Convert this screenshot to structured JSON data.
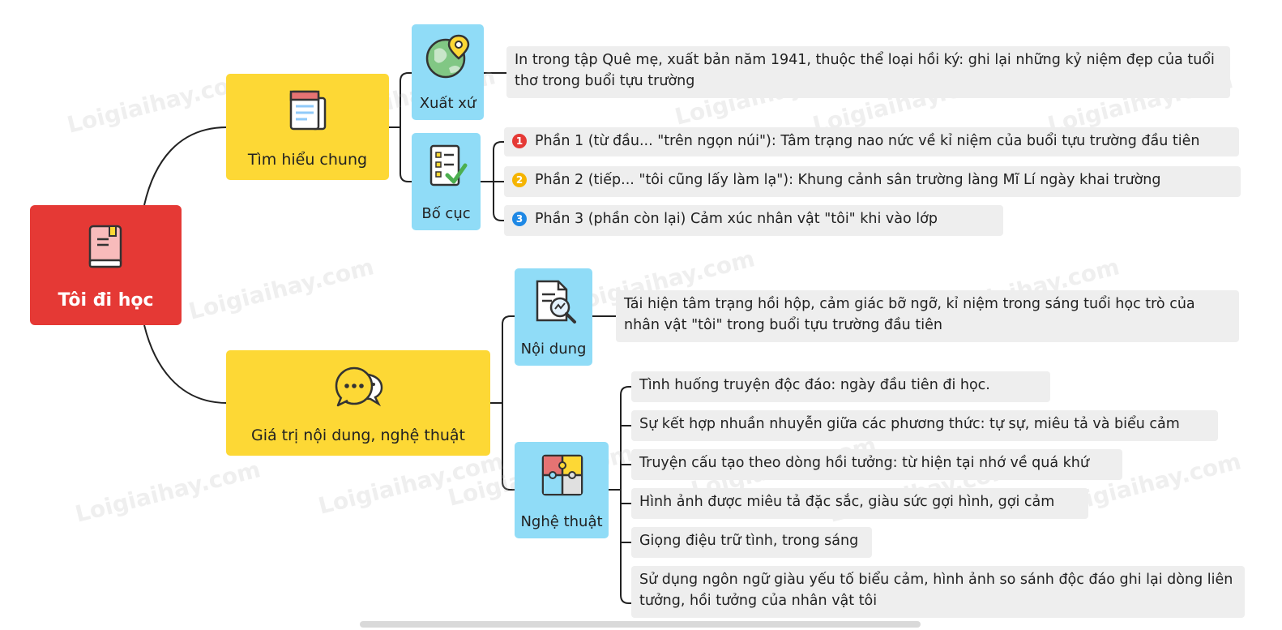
{
  "root": {
    "title": "Tôi đi học",
    "color": "#e53935"
  },
  "branches": [
    {
      "title": "Tìm hiểu chung",
      "icon": "newspaper-icon",
      "children": [
        {
          "title": "Xuất xứ",
          "icon": "globe-pin-icon",
          "leaves": [
            {
              "text": "In trong tập Quê mẹ, xuất bản năm 1941, thuộc thể loại hồi ký: ghi lại những kỷ niệm đẹp của tuổi thơ trong buổi tựu trường"
            }
          ]
        },
        {
          "title": "Bố cục",
          "icon": "checklist-icon",
          "leaves": [
            {
              "marker": "1",
              "marker_color": "#e53935",
              "text": "Phần 1 (từ đầu... \"trên ngọn núi\"): Tâm trạng nao nức về kỉ niệm của buổi tựu trường đầu tiên"
            },
            {
              "marker": "2",
              "marker_color": "#f5b400",
              "text": "Phần 2 (tiếp... \"tôi cũng lấy làm lạ\"): Khung cảnh sân trường làng Mĩ Lí ngày khai trường"
            },
            {
              "marker": "3",
              "marker_color": "#1e88e5",
              "text": "Phần 3 (phần còn lại) Cảm xúc nhân vật \"tôi\" khi vào lớp"
            }
          ]
        }
      ]
    },
    {
      "title": "Giá trị nội dung, nghệ thuật",
      "icon": "chat-bubbles-icon",
      "children": [
        {
          "title": "Nội dung",
          "icon": "document-search-icon",
          "leaves": [
            {
              "text": "Tái hiện tâm trạng hồi hộp, cảm giác bỡ ngỡ, kỉ niệm trong sáng tuổi học trò của nhân vật \"tôi\" trong buổi tựu trường đầu tiên"
            }
          ]
        },
        {
          "title": "Nghệ thuật",
          "icon": "puzzle-icon",
          "leaves": [
            {
              "text": "Tình huống truyện độc đáo: ngày đầu tiên đi học."
            },
            {
              "text": "Sự kết hợp nhuần nhuyễn giữa các phương thức: tự sự, miêu tả và biểu cảm"
            },
            {
              "text": "Truyện cấu tạo theo dòng hồi tưởng: từ hiện tại nhớ về quá khứ"
            },
            {
              "text": "Hình ảnh được miêu tả đặc sắc, giàu sức gợi hình, gợi cảm"
            },
            {
              "text": "Giọng điệu trữ tình, trong sáng"
            },
            {
              "text": "Sử dụng ngôn ngữ giàu yếu tố biểu cảm, hình ảnh so sánh độc đáo ghi lại dòng liên tưởng, hồi tưởng của nhân vật tôi"
            }
          ]
        }
      ]
    }
  ],
  "colors": {
    "branch": "#fdd835",
    "sub": "#90dcf7",
    "leaf": "#eeeeee",
    "line": "#222222"
  },
  "watermark": "Loigiaihay.com"
}
